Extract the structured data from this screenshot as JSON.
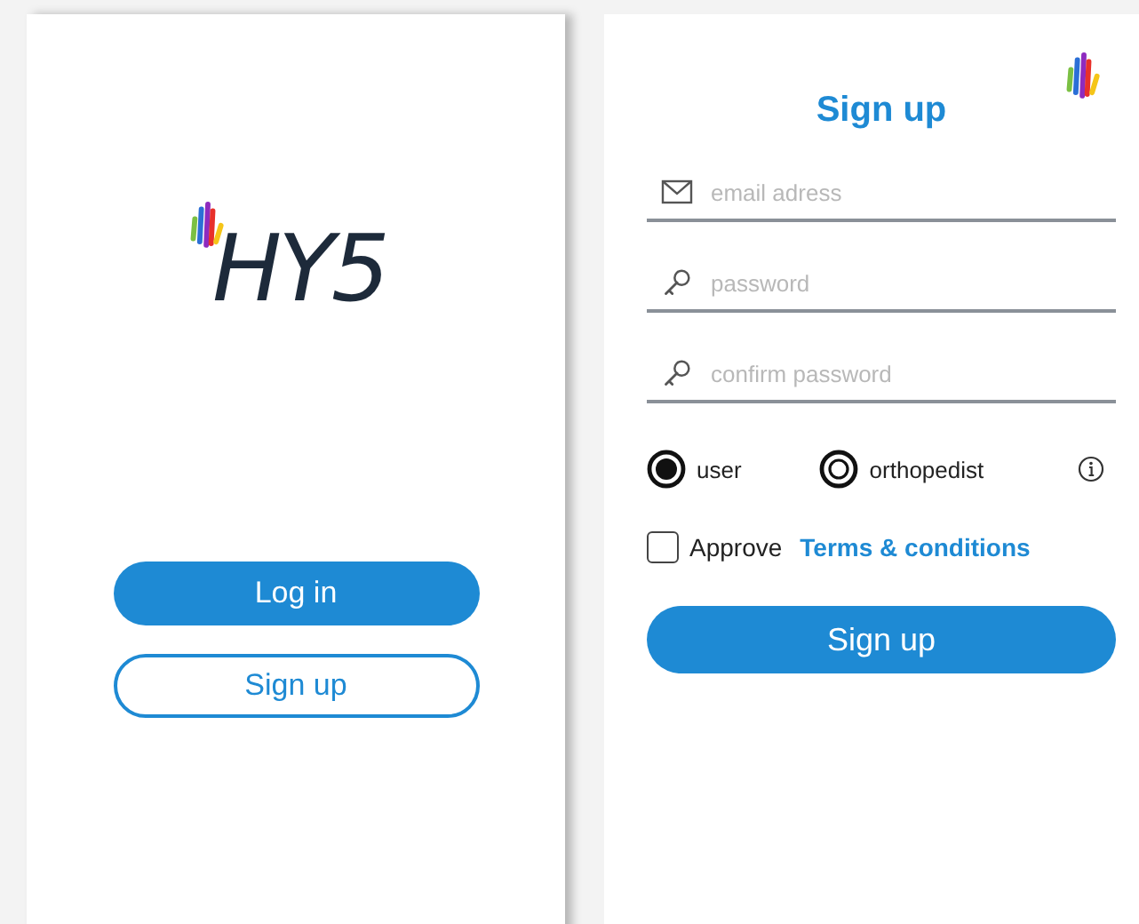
{
  "welcome": {
    "logo": "HY5",
    "buttons": [
      {
        "label": "Log in",
        "kind": "filled"
      },
      {
        "label": "Sign up",
        "kind": "outline"
      }
    ]
  },
  "signup": {
    "title": "Sign up",
    "fields": [
      {
        "placeholder": "email adress",
        "kind": "email"
      },
      {
        "placeholder": "password",
        "kind": "password"
      },
      {
        "placeholder": "confirm password",
        "kind": "password"
      }
    ],
    "roles": [
      {
        "label": "user",
        "selected": true
      },
      {
        "label": "orthopedist",
        "selected": false
      }
    ],
    "approve": {
      "label": "Approve",
      "link": "Terms & conditions",
      "checked": false
    },
    "button": "Sign up"
  }
}
